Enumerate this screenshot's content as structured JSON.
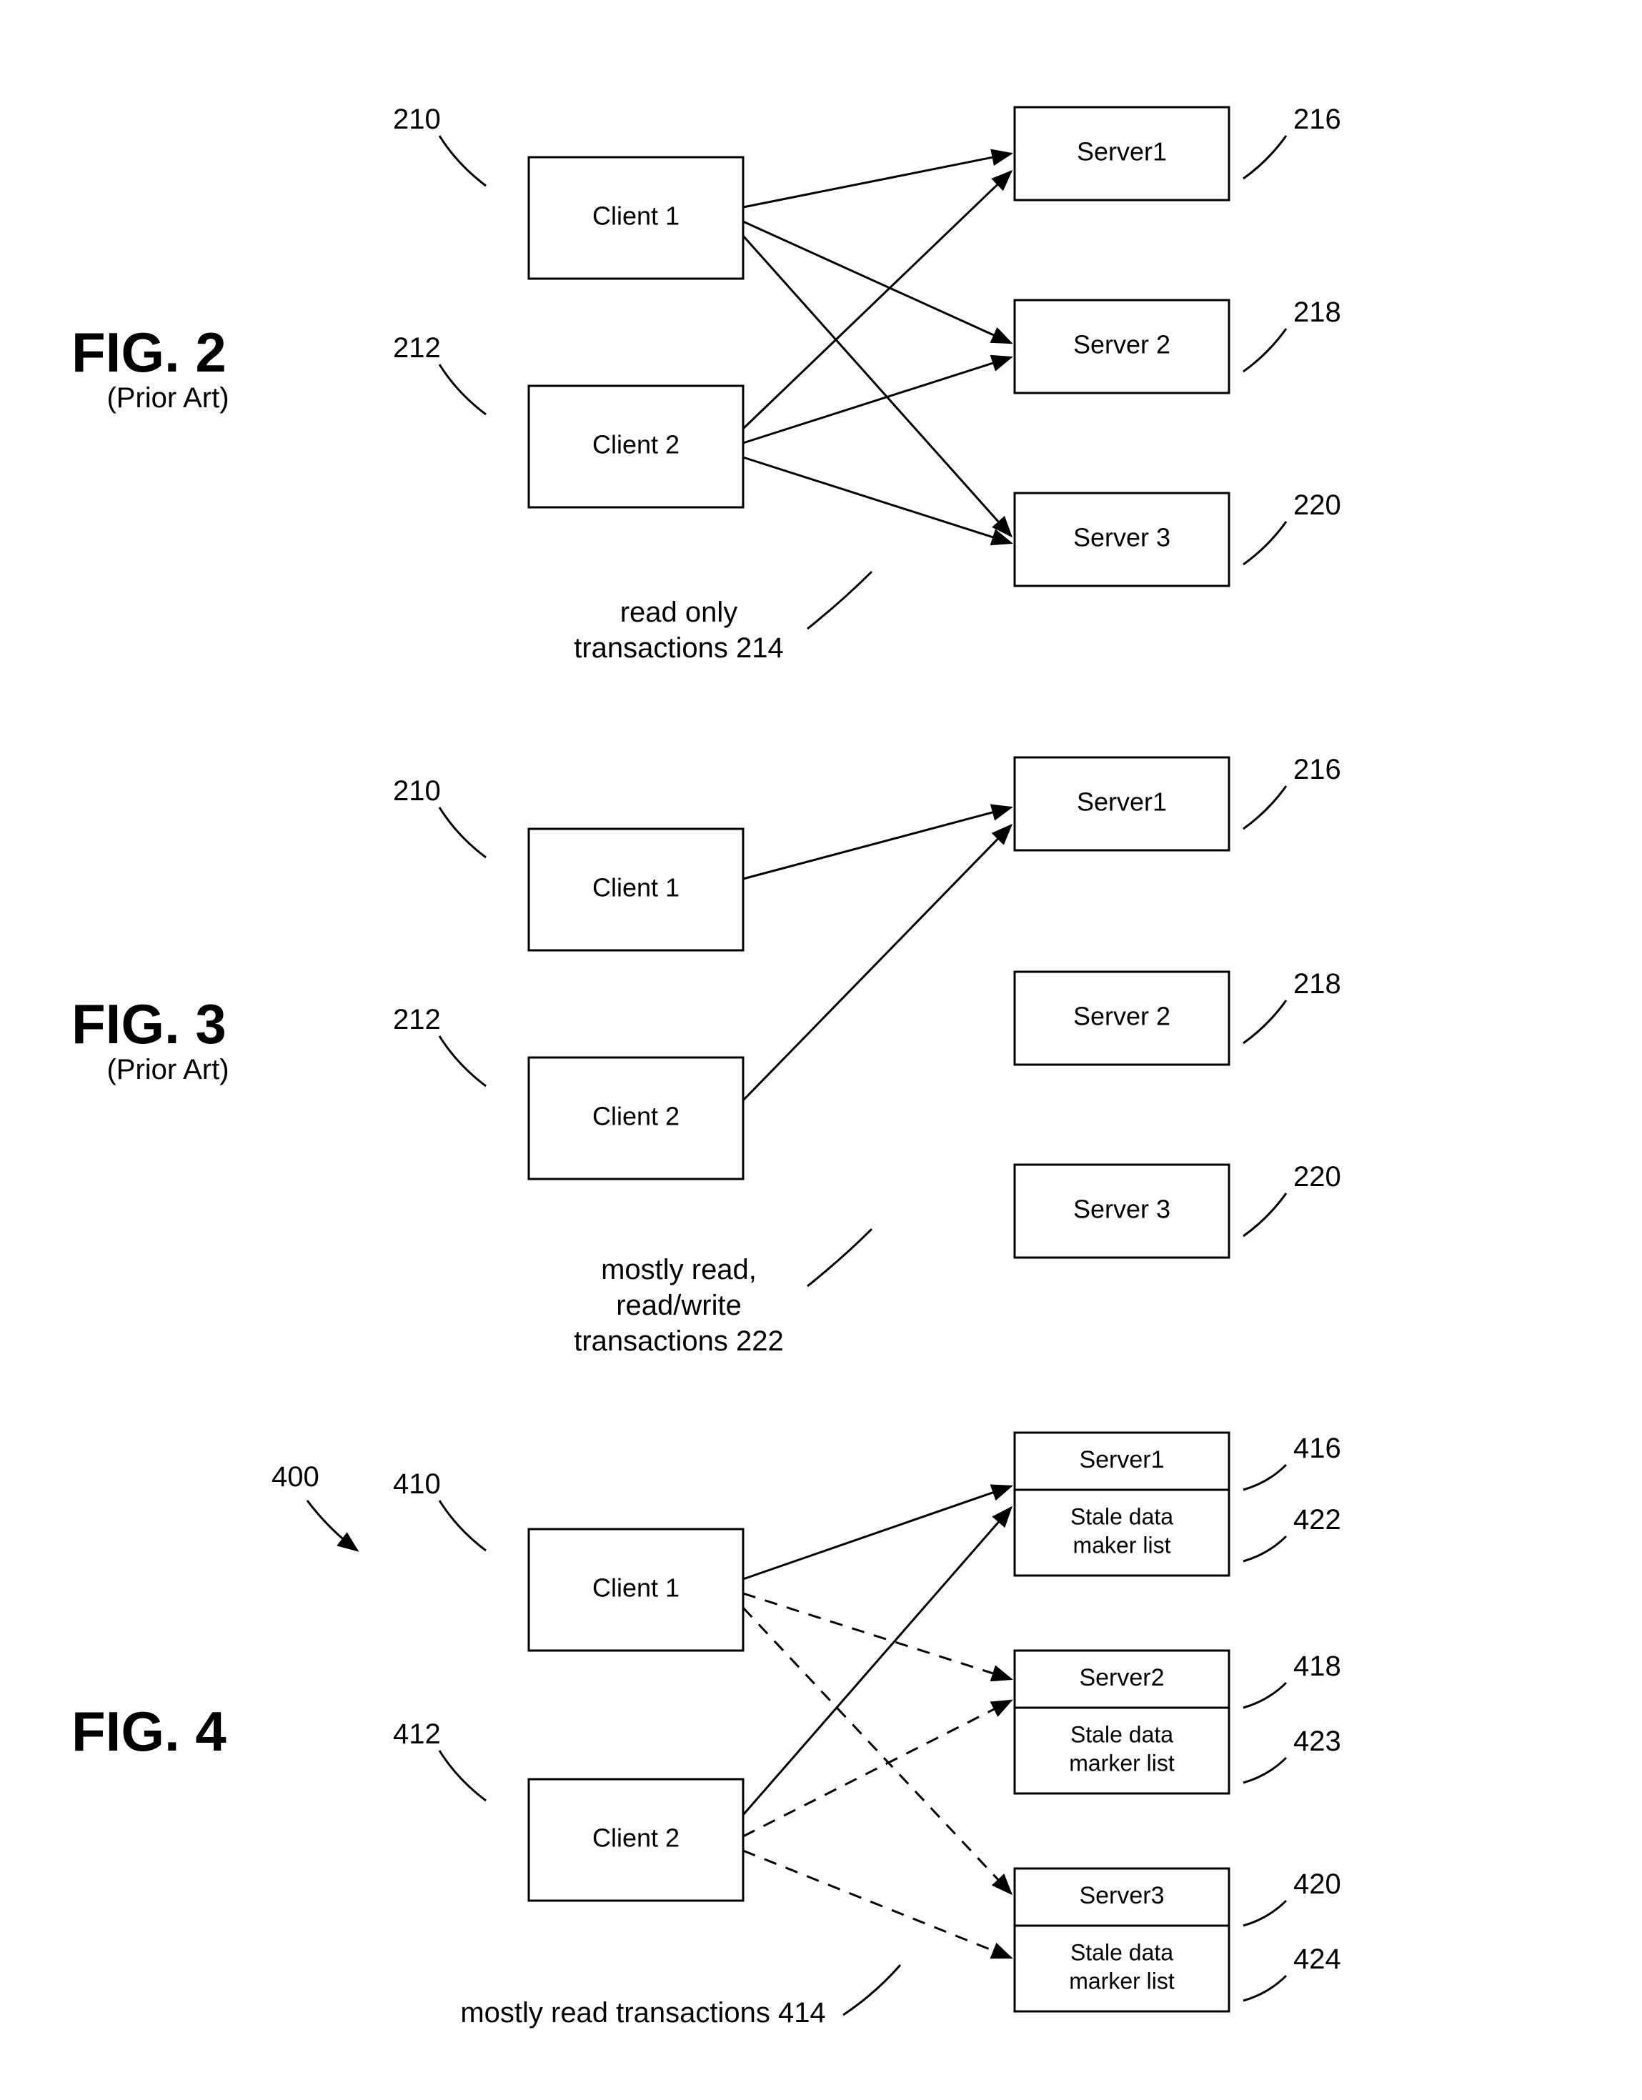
{
  "fig2": {
    "title": "FIG. 2",
    "subtitle": "(Prior Art)",
    "client1": {
      "label": "Client 1",
      "ref": "210"
    },
    "client2": {
      "label": "Client 2",
      "ref": "212"
    },
    "server1": {
      "label": "Server1",
      "ref": "216"
    },
    "server2": {
      "label": "Server 2",
      "ref": "218"
    },
    "server3": {
      "label": "Server 3",
      "ref": "220"
    },
    "caption_line1": "read only",
    "caption_line2": "transactions 214"
  },
  "fig3": {
    "title": "FIG. 3",
    "subtitle": "(Prior Art)",
    "client1": {
      "label": "Client 1",
      "ref": "210"
    },
    "client2": {
      "label": "Client 2",
      "ref": "212"
    },
    "server1": {
      "label": "Server1",
      "ref": "216"
    },
    "server2": {
      "label": "Server 2",
      "ref": "218"
    },
    "server3": {
      "label": "Server 3",
      "ref": "220"
    },
    "caption_line1": "mostly read,",
    "caption_line2": "read/write",
    "caption_line3": "transactions 222"
  },
  "fig4": {
    "title": "FIG. 4",
    "ref": "400",
    "client1": {
      "label": "Client 1",
      "ref": "410"
    },
    "client2": {
      "label": "Client 2",
      "ref": "412"
    },
    "server1": {
      "label": "Server1",
      "ref": "416",
      "stale_line1": "Stale data",
      "stale_line2": "maker list",
      "stale_ref": "422"
    },
    "server2": {
      "label": "Server2",
      "ref": "418",
      "stale_line1": "Stale data",
      "stale_line2": "marker list",
      "stale_ref": "423"
    },
    "server3": {
      "label": "Server3",
      "ref": "420",
      "stale_line1": "Stale data",
      "stale_line2": "marker list",
      "stale_ref": "424"
    },
    "caption": "mostly read transactions 414"
  }
}
